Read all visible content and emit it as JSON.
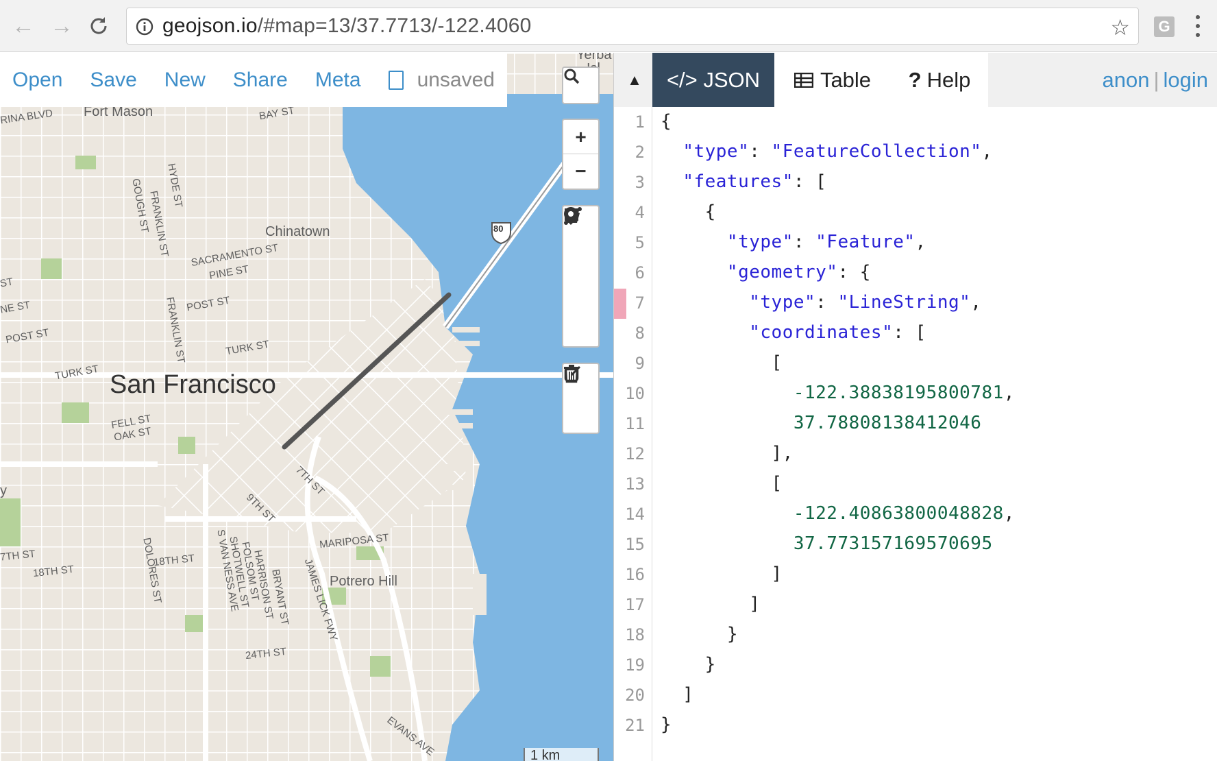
{
  "browser": {
    "url_host": "geojson.io",
    "url_rest": "/#map=13/37.7713/-122.4060",
    "extension_letter": "G"
  },
  "menu": {
    "open": "Open",
    "save": "Save",
    "new": "New",
    "share": "Share",
    "meta": "Meta",
    "unsaved": "unsaved"
  },
  "map": {
    "labels": {
      "yerba1": "Yerba",
      "yerba2": "Isl",
      "fort_mason": "Fort Mason",
      "marina_blvd": "RINA BLVD",
      "bay_st": "BAY ST",
      "hyde_st": "HYDE ST",
      "gough_st": "GOUGH ST",
      "franklin_st": "FRANKLIN ST",
      "franklin_st2": "FRANKLIN ST",
      "chinatown": "Chinatown",
      "sacramento_st": "SACRAMENTO ST",
      "pine_st": "PINE ST",
      "st_left": "ST",
      "ne_st": "NE ST",
      "post_st": "POST ST",
      "post_st2": "POST ST",
      "turk_st": "TURK ST",
      "turk_st2": "TURK ST",
      "san_francisco": "San Francisco",
      "fell_st": "FELL ST",
      "oak_st": "OAK ST",
      "ninth_st": "9TH ST",
      "seventh_st": "7TH ST",
      "y_left": "y",
      "seventeenth_st": "7TH ST",
      "eighteenth_st": "18TH ST",
      "eighteenth_st2": "18TH ST",
      "dolores_st": "DOLORES ST",
      "svanness": "S VAN NESS AVE",
      "shotwell": "SHOTWELL ST",
      "folsom": "FOLSOM ST",
      "harrison": "HARRISON ST",
      "bryant": "BRYANT ST",
      "james_lick": "JAMES LICK FWY",
      "mariposa": "MARIPOSA ST",
      "potrero_hill": "Potrero Hill",
      "twentyfourth": "24TH ST",
      "evans": "EVANS AVE",
      "i80": "80"
    },
    "scale_label": "1 km"
  },
  "controls": {
    "search": "search-icon",
    "zoom_in": "+",
    "zoom_out": "−"
  },
  "pane": {
    "collapse": "▲",
    "tab_json": "</> JSON",
    "tab_table": "Table",
    "tab_help": "Help",
    "user_anon": "anon",
    "user_sep": "|",
    "user_login": "login"
  },
  "editor": {
    "line_numbers": [
      "1",
      "2",
      "3",
      "4",
      "5",
      "6",
      "7",
      "8",
      "9",
      "10",
      "11",
      "12",
      "13",
      "14",
      "15",
      "16",
      "17",
      "18",
      "19",
      "20",
      "21"
    ],
    "lines": [
      [
        {
          "t": "p",
          "v": "{"
        }
      ],
      [
        {
          "t": "p",
          "v": "  "
        },
        {
          "t": "k",
          "v": "\"type\""
        },
        {
          "t": "p",
          "v": ": "
        },
        {
          "t": "s",
          "v": "\"FeatureCollection\""
        },
        {
          "t": "p",
          "v": ","
        }
      ],
      [
        {
          "t": "p",
          "v": "  "
        },
        {
          "t": "k",
          "v": "\"features\""
        },
        {
          "t": "p",
          "v": ": ["
        }
      ],
      [
        {
          "t": "p",
          "v": "    {"
        }
      ],
      [
        {
          "t": "p",
          "v": "      "
        },
        {
          "t": "k",
          "v": "\"type\""
        },
        {
          "t": "p",
          "v": ": "
        },
        {
          "t": "s",
          "v": "\"Feature\""
        },
        {
          "t": "p",
          "v": ","
        }
      ],
      [
        {
          "t": "p",
          "v": "      "
        },
        {
          "t": "k",
          "v": "\"geometry\""
        },
        {
          "t": "p",
          "v": ": {"
        }
      ],
      [
        {
          "t": "p",
          "v": "        "
        },
        {
          "t": "k",
          "v": "\"type\""
        },
        {
          "t": "p",
          "v": ": "
        },
        {
          "t": "s",
          "v": "\"LineString\""
        },
        {
          "t": "p",
          "v": ","
        }
      ],
      [
        {
          "t": "p",
          "v": "        "
        },
        {
          "t": "k",
          "v": "\"coordinates\""
        },
        {
          "t": "p",
          "v": ": ["
        }
      ],
      [
        {
          "t": "p",
          "v": "          ["
        }
      ],
      [
        {
          "t": "p",
          "v": "            "
        },
        {
          "t": "n",
          "v": "-122.38838195800781"
        },
        {
          "t": "p",
          "v": ","
        }
      ],
      [
        {
          "t": "p",
          "v": "            "
        },
        {
          "t": "n",
          "v": "37.78808138412046"
        }
      ],
      [
        {
          "t": "p",
          "v": "          ],"
        }
      ],
      [
        {
          "t": "p",
          "v": "          ["
        }
      ],
      [
        {
          "t": "p",
          "v": "            "
        },
        {
          "t": "n",
          "v": "-122.40863800048828"
        },
        {
          "t": "p",
          "v": ","
        }
      ],
      [
        {
          "t": "p",
          "v": "            "
        },
        {
          "t": "n",
          "v": "37.773157169570695"
        }
      ],
      [
        {
          "t": "p",
          "v": "          ]"
        }
      ],
      [
        {
          "t": "p",
          "v": "        ]"
        }
      ],
      [
        {
          "t": "p",
          "v": "      }"
        }
      ],
      [
        {
          "t": "p",
          "v": "    }"
        }
      ],
      [
        {
          "t": "p",
          "v": "  ]"
        }
      ],
      [
        {
          "t": "p",
          "v": "}"
        }
      ]
    ]
  },
  "colors": {
    "accent": "#3d8ec9",
    "active_tab": "#34495e",
    "water": "#7eb6e2",
    "land": "#ece7df",
    "park": "#b5d29a",
    "json_key": "#2a23d6",
    "json_number": "#116644",
    "drawn_line": "#555555"
  }
}
